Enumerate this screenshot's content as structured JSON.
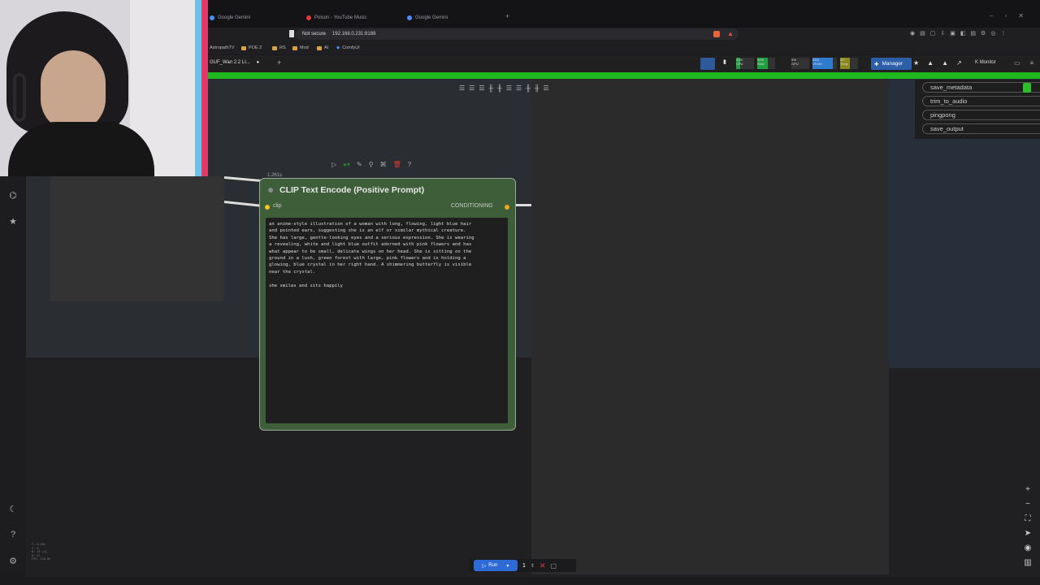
{
  "browser": {
    "tabs": [
      {
        "label": "Google Gemini",
        "icon": "gemini-icon",
        "color": "#4b8ef5"
      },
      {
        "label": "Poison - YouTube Music",
        "icon": "youtube-music-icon",
        "color": "#e53935"
      },
      {
        "label": "Google Gemini",
        "icon": "gemini-icon",
        "color": "#4b8ef5"
      }
    ],
    "security": "Not secure",
    "url": "192.168.0.231:8188",
    "bookmarks": [
      "AstropathTV",
      "POE 2",
      "RS",
      "Mod",
      "AI",
      "ComfyUI"
    ]
  },
  "comfy": {
    "workflow_tab": "GUF_Wan 2.2 LI...",
    "stats": [
      {
        "label": "CPU",
        "value": "23%"
      },
      {
        "label": "RAM",
        "value": "60%"
      },
      {
        "label": "GPU",
        "value": "0%"
      },
      {
        "label": "VRAM",
        "value": "83%"
      },
      {
        "label": "Temp",
        "value": "53°"
      }
    ],
    "manager_label": "Manager",
    "monitor_label": "Monitor",
    "accent": "#1fb91f"
  },
  "node": {
    "timing": "1.261s",
    "title": "CLIP Text Encode (Positive Prompt)",
    "input_label": "clip",
    "output_label": "CONDITIONING",
    "prompt_text": "an anime-style illustration of a woman with long, flowing, light blue hair\nand pointed ears, suggesting she is an elf or similar mythical creature.\nShe has large, gentle-looking eyes and a serious expression. She is wearing\na revealing, white and light blue outfit adorned with pink flowers and has\nwhat appear to be small, delicate wings on her head. She is sitting on the\nground in a lush, green forest with large, pink flowers and is holding a\nglowing, blue crystal in her right hand. A shimmering butterfly is visible\nnear the crystal.\n\nshe smiles and sits happily",
    "color": "#3d5e39"
  },
  "right_panel": {
    "items": [
      "save_metadata",
      "trim_to_audio",
      "pingpong",
      "save_output"
    ]
  },
  "runbar": {
    "run_label": "Run",
    "queue_count": "1"
  },
  "status_overlay": [
    "T: 0.00s",
    "I: 0",
    "N: 33 [4]",
    "V: 47",
    "FPS: 120.66"
  ]
}
